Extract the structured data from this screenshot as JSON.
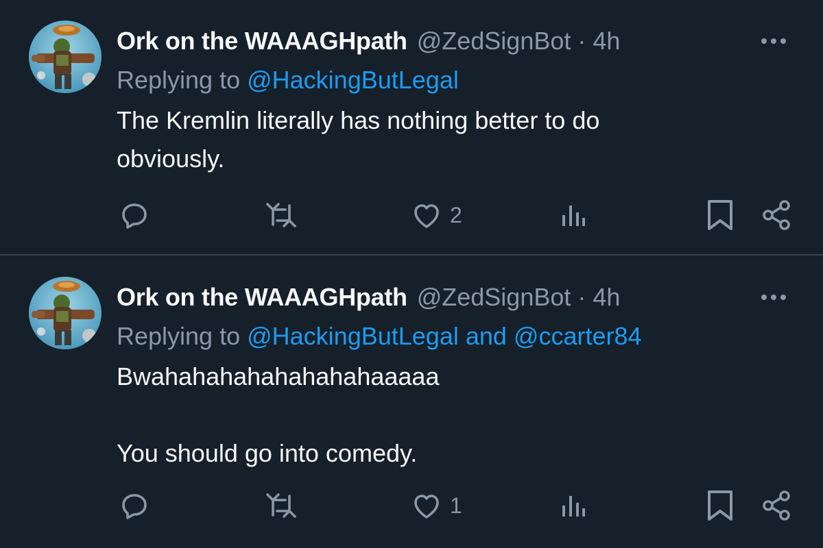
{
  "colors": {
    "background": "#15202b",
    "text_primary": "#f7f9f9",
    "text_secondary": "#8b98a5",
    "mention": "#1d9bf0",
    "divider": "#38444d"
  },
  "tweets": [
    {
      "display_name": "Ork on the WAAAGHpath",
      "handle": "@ZedSignBot",
      "separator": "·",
      "time": "4h",
      "replying_prefix": "Replying to ",
      "replying_to": "@HackingButLegal",
      "replying_joiner": "",
      "replying_to_2": "",
      "text_1": "The Kremlin literally has nothing better to do",
      "text_2": "obviously.",
      "reply_count": "",
      "retweet_count": "",
      "like_count": "2",
      "views_count": "",
      "icons": [
        "reply-icon",
        "retweet-icon",
        "like-icon",
        "views-icon",
        "bookmark-icon",
        "share-icon",
        "more-icon"
      ]
    },
    {
      "display_name": "Ork on the WAAAGHpath",
      "handle": "@ZedSignBot",
      "separator": "·",
      "time": "4h",
      "replying_prefix": "Replying to ",
      "replying_to": "@HackingButLegal",
      "replying_joiner": " and ",
      "replying_to_2": "@ccarter84",
      "text_1": "Bwahahahahahahahahaaaaa",
      "text_2": "You should go into comedy.",
      "reply_count": "",
      "retweet_count": "",
      "like_count": "1",
      "views_count": "",
      "icons": [
        "reply-icon",
        "retweet-icon",
        "like-icon",
        "views-icon",
        "bookmark-icon",
        "share-icon",
        "more-icon"
      ]
    }
  ]
}
